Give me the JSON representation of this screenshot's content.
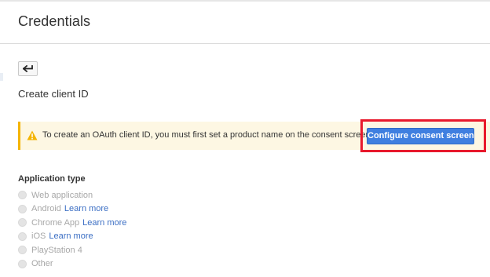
{
  "header": {
    "title": "Credentials"
  },
  "toolbar": {
    "back_icon": "back-arrow-icon"
  },
  "page": {
    "subtitle": "Create client ID"
  },
  "alert": {
    "icon": "warning-icon",
    "accent_color": "#f4b400",
    "background_color": "#fdf7e3",
    "message": "To create an OAuth client ID, you must first set a product name on the consent screen",
    "button_label": "Configure consent screen",
    "button_color": "#3f7fe0",
    "highlight_color": "#e8192c"
  },
  "application_type": {
    "label": "Application type",
    "options": [
      {
        "label": "Web application",
        "link": ""
      },
      {
        "label": "Android",
        "link": "Learn more"
      },
      {
        "label": "Chrome App",
        "link": "Learn more"
      },
      {
        "label": "iOS",
        "link": "Learn more"
      },
      {
        "label": "PlayStation 4",
        "link": ""
      },
      {
        "label": "Other",
        "link": ""
      }
    ]
  }
}
